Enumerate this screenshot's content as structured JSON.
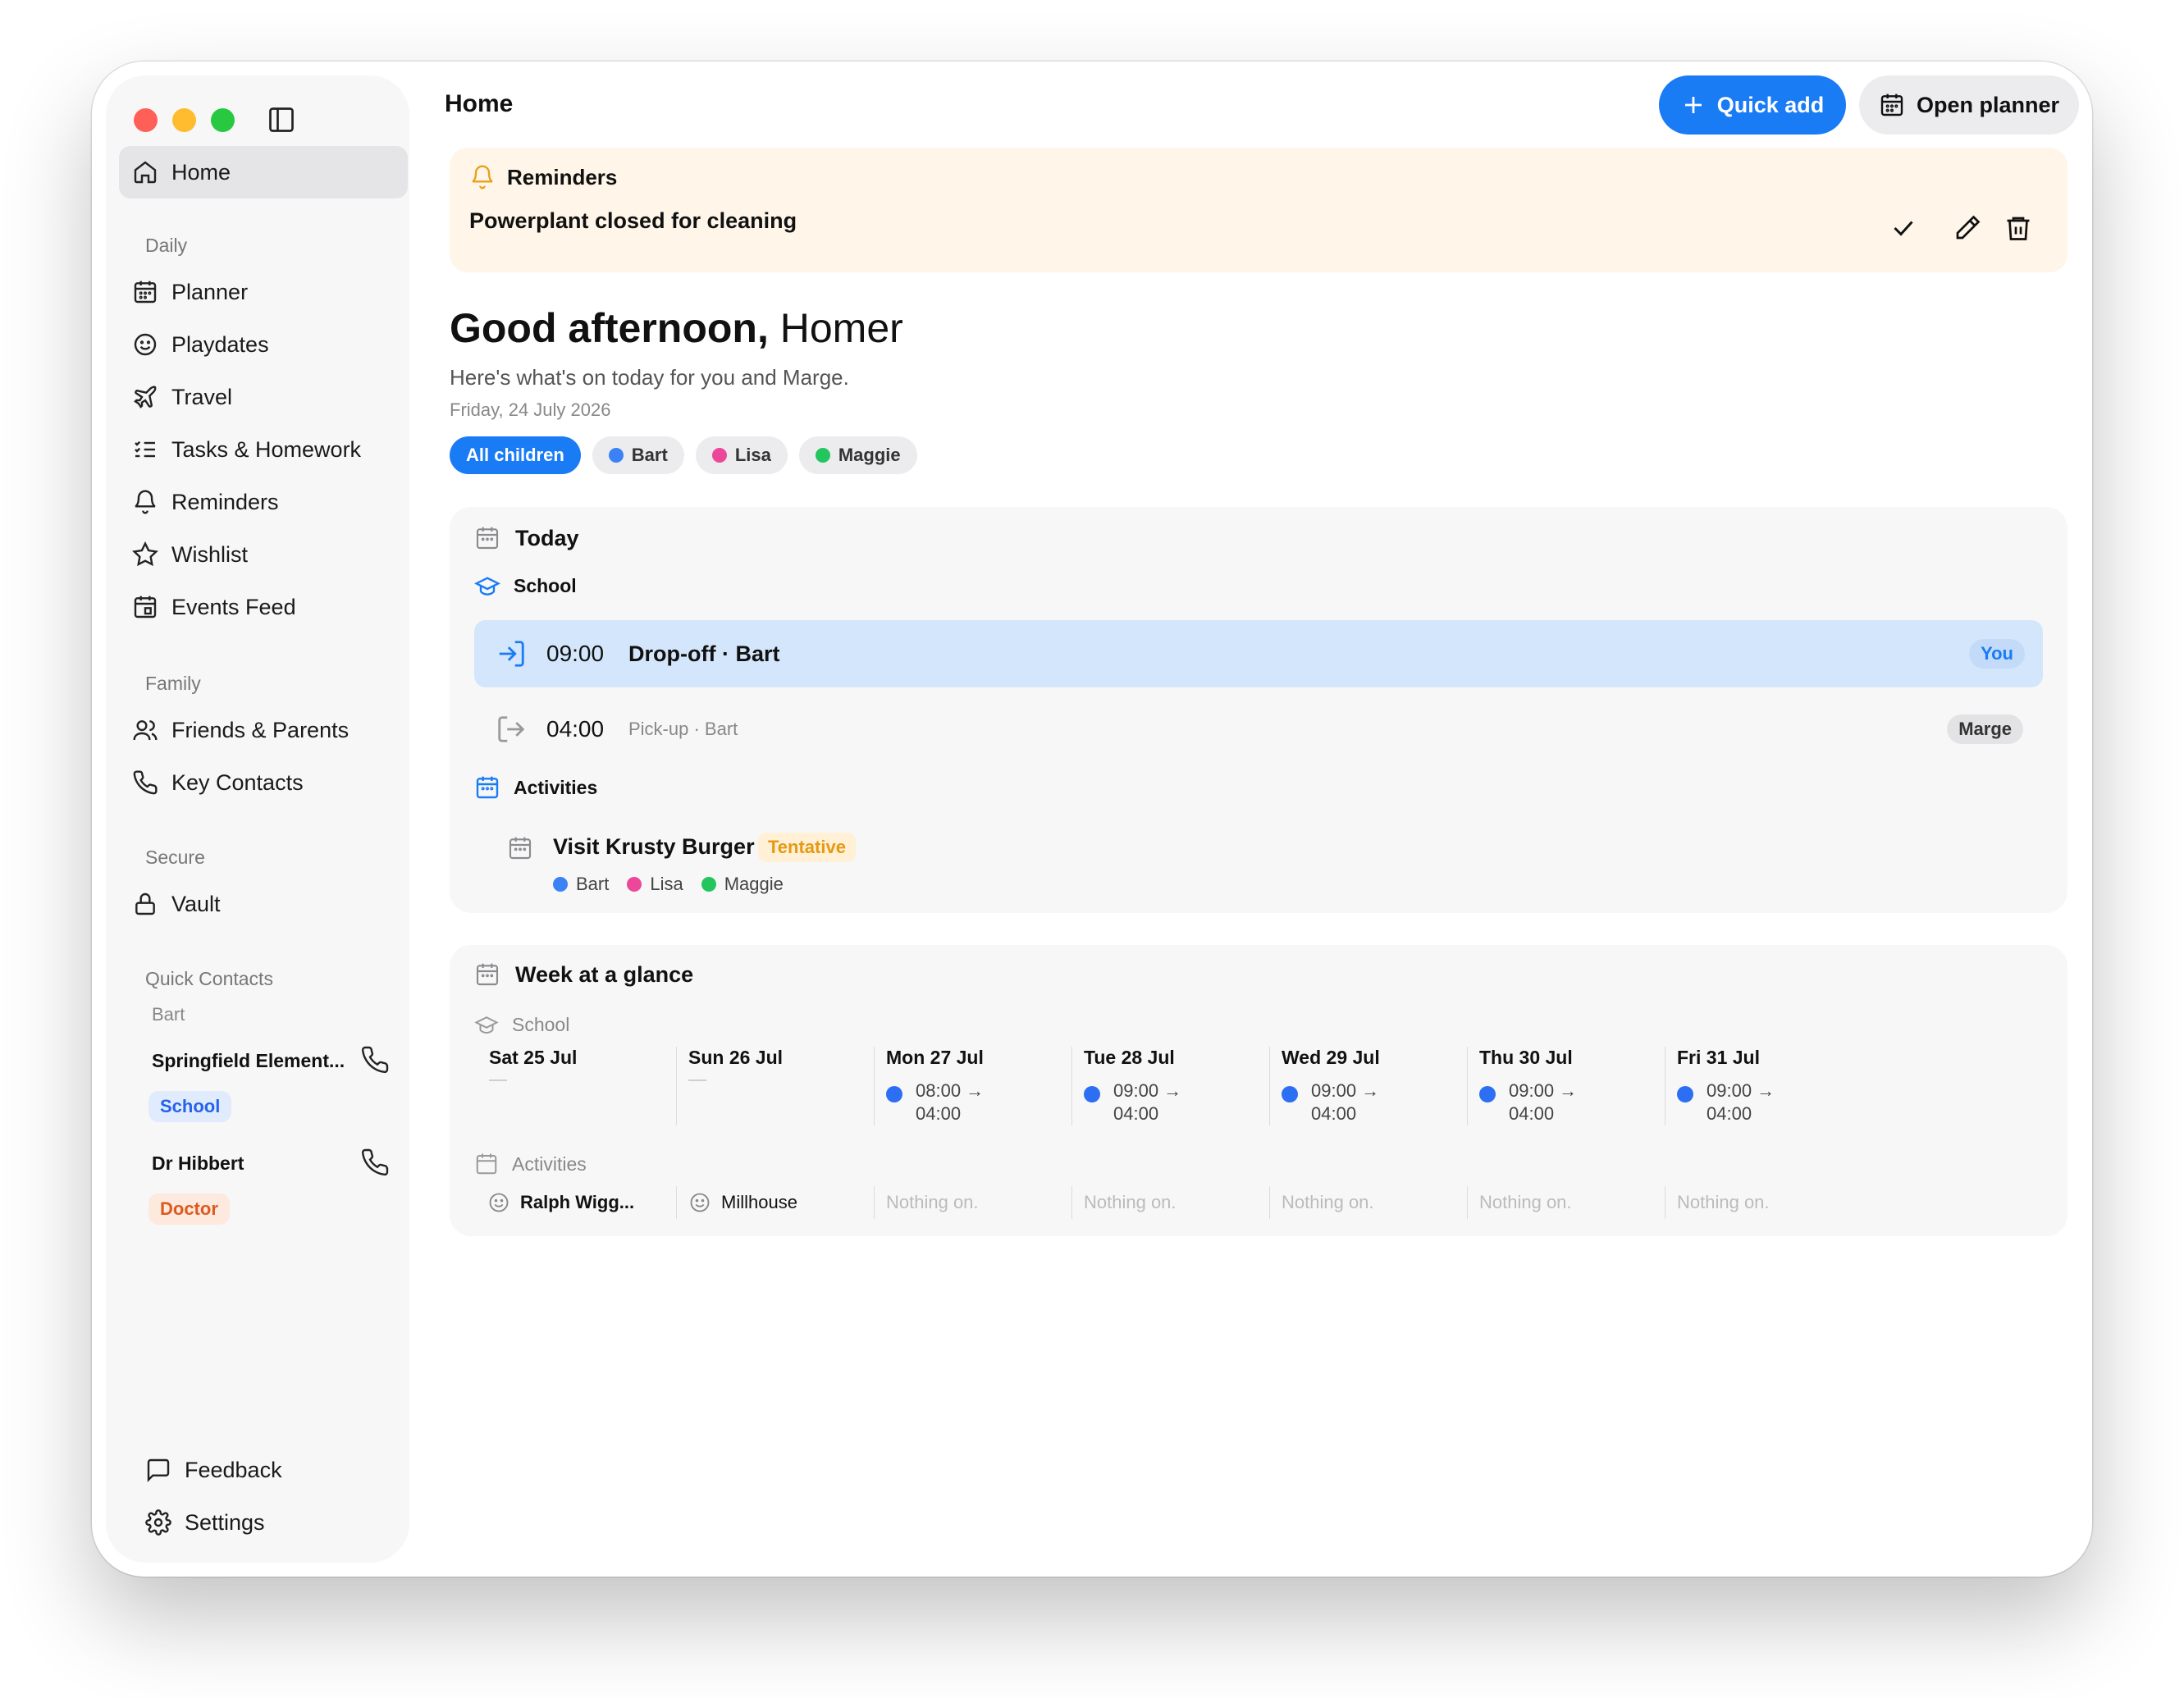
{
  "sidebar": {
    "home_label": "Home",
    "groups": {
      "daily": "Daily",
      "family": "Family",
      "secure": "Secure",
      "quick_contacts": "Quick Contacts"
    },
    "daily_items": [
      "Planner",
      "Playdates",
      "Travel",
      "Tasks & Homework",
      "Reminders",
      "Wishlist",
      "Events Feed"
    ],
    "family_items": [
      "Friends & Parents",
      "Key Contacts"
    ],
    "secure_items": [
      "Vault"
    ],
    "quick_contacts": {
      "child": "Bart",
      "contacts": [
        {
          "name": "Springfield Element...",
          "tag": "School"
        },
        {
          "name": "Dr Hibbert",
          "tag": "Doctor"
        }
      ]
    },
    "footer": {
      "feedback": "Feedback",
      "settings": "Settings"
    }
  },
  "header": {
    "title": "Home",
    "quick_add": "Quick add",
    "open_planner": "Open planner"
  },
  "reminders": {
    "heading": "Reminders",
    "text": "Powerplant closed for cleaning"
  },
  "greeting": {
    "bold": "Good afternoon,",
    "name": "Homer",
    "subtitle": "Here's what's on today for you and Marge.",
    "date": "Friday, 24 July 2026"
  },
  "filters": {
    "all": "All children",
    "children": [
      {
        "name": "Bart",
        "color": "#3b82f6"
      },
      {
        "name": "Lisa",
        "color": "#ec4899"
      },
      {
        "name": "Maggie",
        "color": "#22c55e"
      }
    ]
  },
  "today": {
    "heading": "Today",
    "school_label": "School",
    "events": [
      {
        "time": "09:00",
        "title": "Drop-off · Bart",
        "badge": "You"
      },
      {
        "time": "04:00",
        "title": "Pick-up · Bart",
        "badge": "Marge"
      }
    ],
    "activities_label": "Activities",
    "activity": {
      "title": "Visit Krusty Burger",
      "status": "Tentative",
      "attendees": [
        "Bart",
        "Lisa",
        "Maggie"
      ]
    }
  },
  "week": {
    "heading": "Week at a glance",
    "school_label": "School",
    "activities_label": "Activities",
    "days": [
      {
        "name": "Sat 25 Jul",
        "school": "—",
        "activity": "Ralph Wigg..."
      },
      {
        "name": "Sun 26 Jul",
        "school": "—",
        "activity": "Millhouse"
      },
      {
        "name": "Mon 27 Jul",
        "start": "08:00 →",
        "end": "04:00",
        "activity": "Nothing on."
      },
      {
        "name": "Tue 28 Jul",
        "start": "09:00 →",
        "end": "04:00",
        "activity": "Nothing on."
      },
      {
        "name": "Wed 29 Jul",
        "start": "09:00 →",
        "end": "04:00",
        "activity": "Nothing on."
      },
      {
        "name": "Thu 30 Jul",
        "start": "09:00 →",
        "end": "04:00",
        "activity": "Nothing on."
      },
      {
        "name": "Fri 31 Jul",
        "start": "09:00 →",
        "end": "04:00",
        "activity": "Nothing on."
      }
    ]
  },
  "colors": {
    "accent": "#1a7cf5",
    "highlight": "#d4e6fb",
    "reminder_bg": "#fff6e9",
    "tentative": "#e69a13",
    "school_badge": "#2563eb",
    "doctor_badge": "#dc5a1e"
  }
}
